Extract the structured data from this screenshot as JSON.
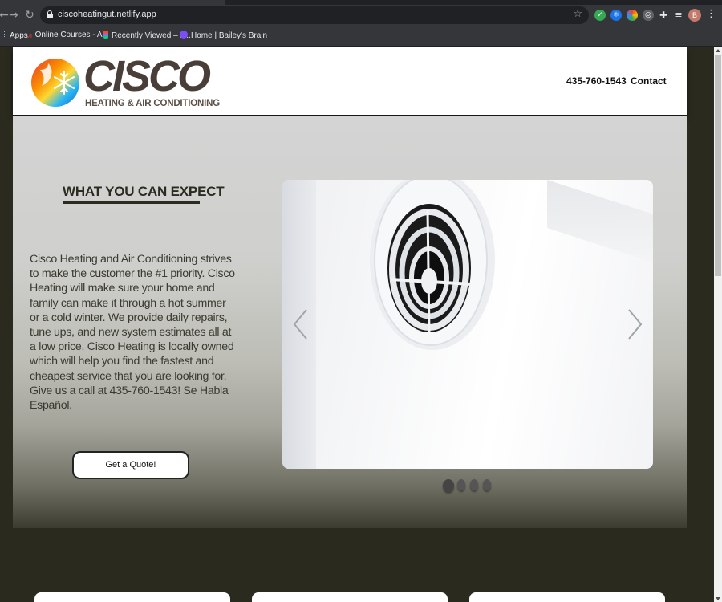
{
  "browser": {
    "url": "ciscoheatingut.netlify.app",
    "bookmarks": [
      {
        "label": "Apps"
      },
      {
        "label": "Online Courses - A..."
      },
      {
        "label": "Recently Viewed – F..."
      },
      {
        "label": "Home | Bailey's Brain"
      }
    ],
    "profile_initial": "B"
  },
  "header": {
    "logo_word": "CISCO",
    "logo_sub": "HEATING & AIR CONDITIONING",
    "nav_phone": "435-760-1543",
    "nav_contact": "Contact"
  },
  "hero": {
    "heading": "WHAT YOU CAN EXPECT",
    "description": "Cisco Heating and Air Conditioning strives to make the customer the #1 priority. Cisco Heating will make sure your home and family can make it through a hot summer or a cold winter. We provide daily repairs, tune ups, and new system estimates all at a low price. Cisco Heating is locally owned which will help you find the fastest and cheapest service that you are looking for. Give us a call at 435-760-1543! Se Habla Español.",
    "cta_label": "Get a Quote!",
    "carousel": {
      "slide_count": 4,
      "active_index": 0
    }
  },
  "colors": {
    "page_bg": "#2a2a1e",
    "heading": "#2b2b1f",
    "logo_text": "#4a3f38"
  }
}
